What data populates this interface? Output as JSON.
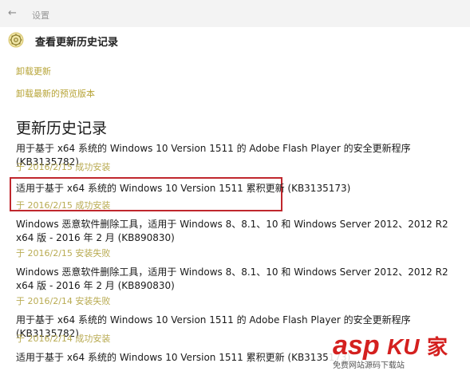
{
  "window": {
    "title": "设置"
  },
  "header": {
    "title": "查看更新历史记录"
  },
  "links": [
    "卸载更新",
    "卸载最新的预览版本"
  ],
  "section_title": "更新历史记录",
  "entries": [
    {
      "title": "用于基于 x64 系统的 Windows 10 Version 1511 的 Adobe Flash Player 的安全更新程序 (KB3135782)",
      "status": "于 2016/2/15 成功安装"
    },
    {
      "title": "适用于基于 x64 系统的 Windows 10 Version 1511 累积更新 (KB3135173)",
      "status": "于 2016/2/15 成功安装"
    },
    {
      "title": "Windows 恶意软件删除工具，适用于 Windows 8、8.1、10 和 Windows Server 2012、2012 R2 x64 版 - 2016 年 2 月 (KB890830)",
      "status": "于 2016/2/15 安装失败"
    },
    {
      "title": "Windows 恶意软件删除工具，适用于 Windows 8、8.1、10 和 Windows Server 2012、2012 R2 x64 版 - 2016 年 2 月 (KB890830)",
      "status": "于 2016/2/14 安装失败"
    },
    {
      "title": "用于基于 x64 系统的 Windows 10 Version 1511 的 Adobe Flash Player 的安全更新程序 (KB3135782)",
      "status": "于 2016/2/14 成功安装"
    },
    {
      "title": "适用于基于 x64 系统的 Windows 10 Version 1511 累积更新 (KB3135173)",
      "status": ""
    }
  ],
  "watermark": {
    "brand": "asp",
    "sub": "免费网站源码下载站"
  },
  "colors": {
    "link": "#b7a437",
    "status": "#b9ab52",
    "highlight": "#c0272d",
    "watermark": "#d4201f"
  }
}
